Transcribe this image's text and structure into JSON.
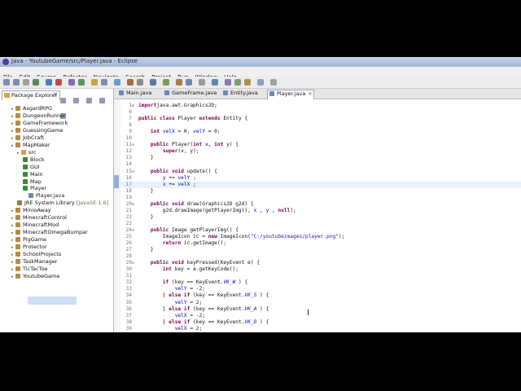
{
  "window": {
    "title": "Java - YoutubeGame/src/Player.java - Eclipse",
    "menu": [
      "File",
      "Edit",
      "Source",
      "Refactor",
      "Navigate",
      "Search",
      "Project",
      "Run",
      "Window",
      "Help"
    ]
  },
  "explorer": {
    "tab_label": "Package Explorer",
    "close_glyph": "✕",
    "tree": [
      {
        "label": "AsgardRPG",
        "kind": "proj",
        "indent": 0
      },
      {
        "label": "DungeonRunner",
        "kind": "proj",
        "indent": 0
      },
      {
        "label": "GameFramework",
        "kind": "proj",
        "indent": 0
      },
      {
        "label": "GuessingGame",
        "kind": "proj",
        "indent": 0
      },
      {
        "label": "JobCraft",
        "kind": "proj",
        "indent": 0
      },
      {
        "label": "MapMaker",
        "kind": "proj",
        "indent": 0
      },
      {
        "label": "src",
        "kind": "pkg",
        "indent": 1
      },
      {
        "label": "Block",
        "kind": "cls",
        "indent": 2
      },
      {
        "label": "GUI",
        "kind": "cls",
        "indent": 2
      },
      {
        "label": "Main",
        "kind": "cls",
        "indent": 2
      },
      {
        "label": "Map",
        "kind": "cls",
        "indent": 2
      },
      {
        "label": "Player",
        "kind": "cls",
        "indent": 2
      },
      {
        "label": "Player.java",
        "kind": "jfile",
        "indent": 3
      },
      {
        "label": "JRE System Library",
        "suffix": " [JavaSE-1.6]",
        "kind": "lib",
        "indent": 1
      },
      {
        "label": "MinioAway",
        "kind": "proj",
        "indent": 0
      },
      {
        "label": "MinecraftControl",
        "kind": "proj",
        "indent": 0
      },
      {
        "label": "MinecraftMod",
        "kind": "proj",
        "indent": 0
      },
      {
        "label": "MinecraftOmegaBumpar",
        "kind": "proj",
        "indent": 0
      },
      {
        "label": "PigGame",
        "kind": "proj",
        "indent": 0
      },
      {
        "label": "Protector",
        "kind": "proj",
        "indent": 0
      },
      {
        "label": "SchoolProjects",
        "kind": "proj",
        "indent": 0
      },
      {
        "label": "TaskManager",
        "kind": "proj",
        "indent": 0
      },
      {
        "label": "TicTacToe",
        "kind": "proj",
        "indent": 0
      },
      {
        "label": "YoutubeGame",
        "kind": "proj",
        "indent": 0
      }
    ]
  },
  "editor": {
    "tabs": [
      {
        "label": "Main.java",
        "active": false
      },
      {
        "label": "GameFrame.java",
        "active": false
      },
      {
        "label": "Entity.java",
        "active": false
      },
      {
        "label": "Player.java",
        "active": true
      }
    ],
    "close_glyph": "✕",
    "lines": [
      {
        "n": "1",
        "fold": "⊕",
        "segs": [
          [
            "kw",
            "import"
          ],
          [
            "",
            "java.awt.Graphics2D;"
          ]
        ]
      },
      {
        "n": "6",
        "segs": []
      },
      {
        "n": "7",
        "segs": [
          [
            "kw",
            "public class"
          ],
          [
            "",
            " Player "
          ],
          [
            "kw",
            "extends"
          ],
          [
            "",
            " Entity {"
          ]
        ]
      },
      {
        "n": "8",
        "segs": []
      },
      {
        "n": "9",
        "segs": [
          [
            "",
            "    "
          ],
          [
            "kw",
            "int"
          ],
          [
            "",
            " "
          ],
          [
            "fld",
            "velX"
          ],
          [
            "",
            " = 0, "
          ],
          [
            "fld",
            "velY"
          ],
          [
            "",
            " = 0;"
          ]
        ]
      },
      {
        "n": "10",
        "segs": []
      },
      {
        "n": "11",
        "fold": "⊖",
        "segs": [
          [
            "",
            "    "
          ],
          [
            "kw",
            "public"
          ],
          [
            "",
            " Player("
          ],
          [
            "kw",
            "int"
          ],
          [
            "",
            " x, "
          ],
          [
            "kw",
            "int"
          ],
          [
            "",
            " y) {"
          ]
        ]
      },
      {
        "n": "12",
        "segs": [
          [
            "",
            "        "
          ],
          [
            "kw",
            "super"
          ],
          [
            "",
            "(x, y);"
          ]
        ]
      },
      {
        "n": "13",
        "segs": [
          [
            "",
            "    }"
          ]
        ]
      },
      {
        "n": "14",
        "segs": []
      },
      {
        "n": "15",
        "fold": "⊖",
        "segs": [
          [
            "",
            "    "
          ],
          [
            "kw",
            "public void"
          ],
          [
            "",
            " update() {"
          ]
        ]
      },
      {
        "n": "16",
        "mark": true,
        "segs": [
          [
            "",
            "        "
          ],
          [
            "fld",
            "y"
          ],
          [
            "",
            " += "
          ],
          [
            "fld",
            "velY"
          ],
          [
            "",
            " ;"
          ]
        ]
      },
      {
        "n": "17",
        "mark": true,
        "hl": true,
        "segs": [
          [
            "",
            "        "
          ],
          [
            "fld",
            "x"
          ],
          [
            "",
            " += "
          ],
          [
            "fld",
            "velX"
          ],
          [
            "",
            " ;"
          ]
        ]
      },
      {
        "n": "18",
        "segs": [
          [
            "",
            "    }"
          ]
        ]
      },
      {
        "n": "19",
        "segs": []
      },
      {
        "n": "20",
        "fold": "⊖",
        "segs": [
          [
            "",
            "    "
          ],
          [
            "kw",
            "public void"
          ],
          [
            "",
            " draw(Graphics2D g2d) {"
          ]
        ]
      },
      {
        "n": "21",
        "segs": [
          [
            "",
            "        g2d.drawImage(getPlayerImg(), "
          ],
          [
            "fld",
            "x"
          ],
          [
            "",
            " , "
          ],
          [
            "fld",
            "y"
          ],
          [
            "",
            " , "
          ],
          [
            "kw",
            "null"
          ],
          [
            "",
            ");"
          ]
        ]
      },
      {
        "n": "22",
        "segs": [
          [
            "",
            "    }"
          ]
        ]
      },
      {
        "n": "23",
        "segs": []
      },
      {
        "n": "24",
        "fold": "⊖",
        "segs": [
          [
            "",
            "    "
          ],
          [
            "kw",
            "public"
          ],
          [
            "",
            " Image getPlayerImg() {"
          ]
        ]
      },
      {
        "n": "25",
        "segs": [
          [
            "",
            "        ImageIcon ic = "
          ],
          [
            "kw",
            "new"
          ],
          [
            "",
            " ImageIcon("
          ],
          [
            "str",
            "\"C:/youtubeimages/player.png\""
          ],
          [
            "",
            ");"
          ]
        ]
      },
      {
        "n": "26",
        "segs": [
          [
            "",
            "        "
          ],
          [
            "kw",
            "return"
          ],
          [
            "",
            " ic.getImage();"
          ]
        ]
      },
      {
        "n": "27",
        "segs": [
          [
            "",
            "    }"
          ]
        ]
      },
      {
        "n": "28",
        "segs": []
      },
      {
        "n": "29",
        "fold": "⊖",
        "segs": [
          [
            "",
            "    "
          ],
          [
            "kw",
            "public void"
          ],
          [
            "",
            " keyPressed(KeyEvent e) {"
          ]
        ]
      },
      {
        "n": "30",
        "segs": [
          [
            "",
            "        "
          ],
          [
            "kw",
            "int"
          ],
          [
            "",
            " key = e.getKeyCode();"
          ]
        ]
      },
      {
        "n": "31",
        "segs": []
      },
      {
        "n": "32",
        "segs": [
          [
            "",
            "        "
          ],
          [
            "kw",
            "if"
          ],
          [
            "",
            " (key == KeyEvent."
          ],
          [
            "cst",
            "VK_W"
          ],
          [
            "",
            " ) {"
          ]
        ]
      },
      {
        "n": "33",
        "segs": [
          [
            "",
            "            "
          ],
          [
            "fld",
            "velY"
          ],
          [
            "",
            " = -2;"
          ]
        ]
      },
      {
        "n": "34",
        "segs": [
          [
            "",
            "        } "
          ],
          [
            "kw",
            "else if"
          ],
          [
            "",
            " (key == KeyEvent."
          ],
          [
            "cst",
            "VK_S"
          ],
          [
            "",
            " ) {"
          ]
        ]
      },
      {
        "n": "35",
        "segs": [
          [
            "",
            "            "
          ],
          [
            "fld",
            "velY"
          ],
          [
            "",
            " = 2;"
          ]
        ]
      },
      {
        "n": "36",
        "segs": [
          [
            "",
            "        } "
          ],
          [
            "kw",
            "else if"
          ],
          [
            "",
            " (key == KeyEvent."
          ],
          [
            "cst",
            "VK_A"
          ],
          [
            "",
            " ) {"
          ]
        ]
      },
      {
        "n": "37",
        "segs": [
          [
            "",
            "            "
          ],
          [
            "fld",
            "velX"
          ],
          [
            "",
            " = -2;"
          ]
        ]
      },
      {
        "n": "38",
        "segs": [
          [
            "",
            "        } "
          ],
          [
            "kw",
            "else if"
          ],
          [
            "",
            " (key == KeyEvent."
          ],
          [
            "cst",
            "VK_D"
          ],
          [
            "",
            " ) {"
          ]
        ]
      },
      {
        "n": "39",
        "segs": [
          [
            "",
            "            "
          ],
          [
            "fld",
            "velX"
          ],
          [
            "",
            " = 2;"
          ]
        ]
      }
    ]
  }
}
